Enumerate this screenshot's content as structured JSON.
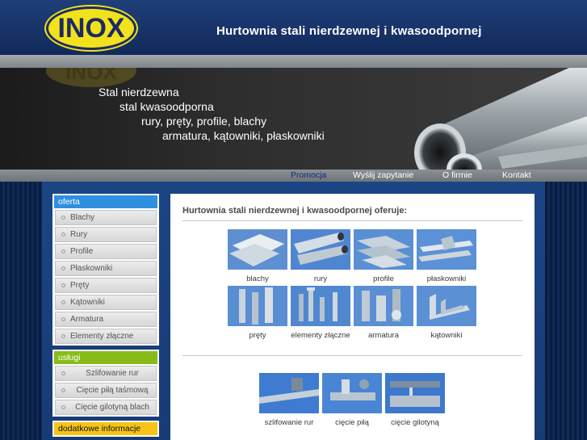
{
  "header": {
    "logo_text": "INOX",
    "site_title": "Hurtownia stali nierdzewnej i kwasoodpornej"
  },
  "banner": {
    "lines": [
      "Stal nierdzewna",
      "stal kwasoodporna",
      "rury, pręty, profile, blachy",
      "armatura, kątowniki, płaskowniki"
    ]
  },
  "nav": {
    "items": [
      "Promocja",
      "Wyślij zapytanie",
      "O firmie",
      "Kontakt"
    ],
    "active": "Promocja"
  },
  "sidebar": {
    "oferta_title": "oferta",
    "oferta_items": [
      "Blachy",
      "Rury",
      "Profile",
      "Płaskowniki",
      "Pręty",
      "Kątowniki",
      "Armatura",
      "Elementy złączne"
    ],
    "uslugi_title": "usługi",
    "uslugi_items": [
      "Szlifowanie rur",
      "Cięcie piłą taśmową",
      "Cięcie gilotyną blach"
    ],
    "extra_title": "dodatkowe informacje"
  },
  "main": {
    "heading": "Hurtownia stali nierdzewnej i kwasoodpornej oferuje:",
    "products": [
      "blachy",
      "rury",
      "profile",
      "płaskowniki",
      "pręty",
      "elementy złączne",
      "armatura",
      "kątowniki"
    ],
    "services": [
      "szlifowanie rur",
      "cięcie piłą",
      "cięcie gilotyną"
    ]
  },
  "colors": {
    "header_blue": "#1a3c7a",
    "logo_yellow": "#f2e21a",
    "oferta_blue": "#2f8fe0",
    "uslugi_green": "#88bb1a",
    "extra_yellow": "#f5c414"
  }
}
